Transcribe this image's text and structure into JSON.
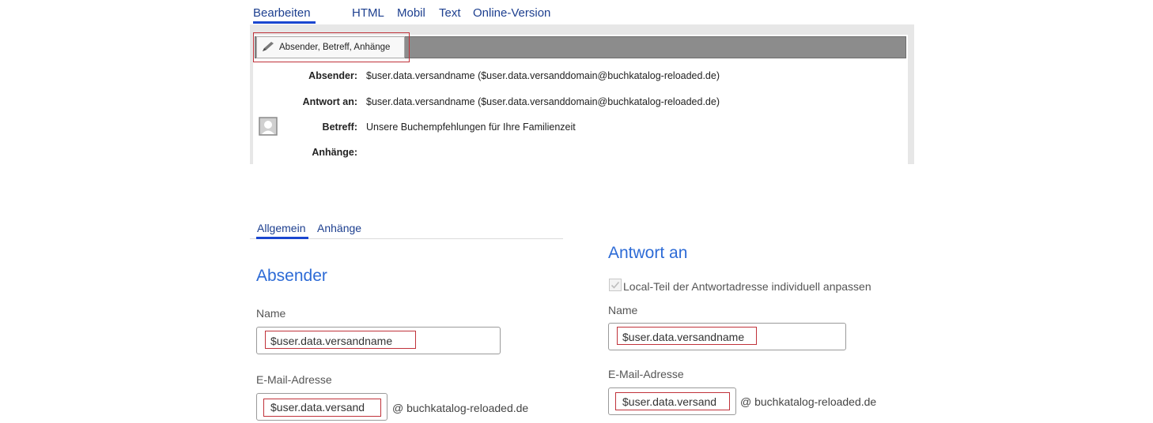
{
  "top_tabs": {
    "edit": "Bearbeiten",
    "html": "HTML",
    "mobile": "Mobil",
    "text": "Text",
    "online": "Online-Version"
  },
  "header": {
    "edit_button_label": "Absender, Betreff, Anhänge",
    "rows": {
      "sender": {
        "label": "Absender:",
        "value": "$user.data.versandname ($user.data.versanddomain@buchkatalog-reloaded.de)"
      },
      "reply_to": {
        "label": "Antwort an:",
        "value": "$user.data.versandname ($user.data.versanddomain@buchkatalog-reloaded.de)"
      },
      "subject": {
        "label": "Betreff:",
        "value": "Unsere Buchempfehlungen für Ihre Familienzeit"
      },
      "attachments": {
        "label": "Anhänge:",
        "value": ""
      }
    }
  },
  "sub_tabs": {
    "general": "Allgemein",
    "attachments": "Anhänge"
  },
  "sender_section": {
    "title": "Absender",
    "name_label": "Name",
    "name_value": "$user.data.versandname",
    "email_label": "E-Mail-Adresse",
    "email_local": "$user.data.versand",
    "email_domain": "@ buchkatalog-reloaded.de"
  },
  "reply_section": {
    "title": "Antwort an",
    "checkbox_label": "Local-Teil der Antwortadresse individuell anpassen",
    "checkbox_checked": true,
    "name_label": "Name",
    "name_value": "$user.data.versandname",
    "email_label": "E-Mail-Adresse",
    "email_local": "$user.data.versand",
    "email_domain": "@ buchkatalog-reloaded.de"
  },
  "colors": {
    "accent_blue": "#2d6bd6",
    "tab_underline": "#1a46d0",
    "highlight_red": "#c0323a"
  },
  "icons": {
    "edit": "pencil-icon",
    "avatar": "person-placeholder-icon",
    "checkbox": "check-icon"
  }
}
